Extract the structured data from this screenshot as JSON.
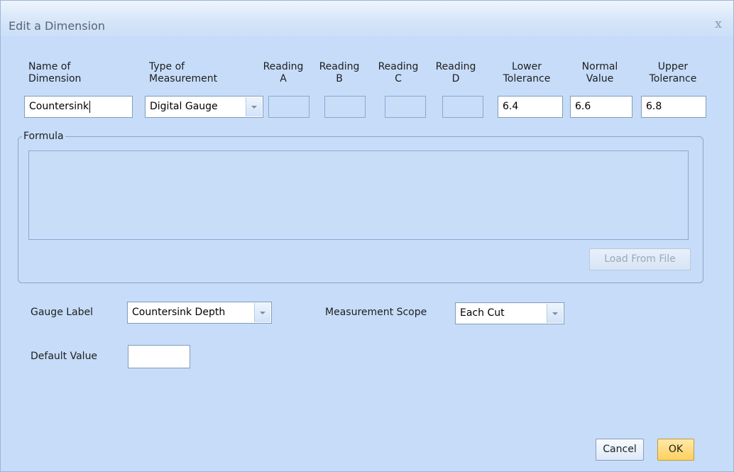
{
  "window": {
    "title": "Edit a Dimension",
    "close_glyph": "x"
  },
  "columns": {
    "name_of_dimension": {
      "line1": "Name of",
      "line2": "Dimension",
      "value": "Countersink"
    },
    "type_of_measurement": {
      "line1": "Type of",
      "line2": "Measurement",
      "value": "Digital Gauge"
    },
    "reading_a": {
      "line1": "Reading",
      "line2": "A",
      "value": ""
    },
    "reading_b": {
      "line1": "Reading",
      "line2": "B",
      "value": ""
    },
    "reading_c": {
      "line1": "Reading",
      "line2": "C",
      "value": ""
    },
    "reading_d": {
      "line1": "Reading",
      "line2": "D",
      "value": ""
    },
    "lower_tolerance": {
      "line1": "Lower",
      "line2": "Tolerance",
      "value": "6.4"
    },
    "normal_value": {
      "line1": "Normal",
      "line2": "Value",
      "value": "6.6"
    },
    "upper_tolerance": {
      "line1": "Upper",
      "line2": "Tolerance",
      "value": "6.8"
    }
  },
  "formula": {
    "legend": "Formula",
    "value": "",
    "load_button_label": "Load From File",
    "load_button_enabled": false
  },
  "gauge": {
    "label": "Gauge Label",
    "value": "Countersink Depth"
  },
  "scope": {
    "label": "Measurement Scope",
    "value": "Each Cut"
  },
  "default_value": {
    "label": "Default Value",
    "value": ""
  },
  "footer": {
    "cancel_label": "Cancel",
    "ok_label": "OK"
  },
  "colors": {
    "dialog_background": "#c6dcf8",
    "ok_button": "#ffd05e",
    "field_border": "#7f9db9"
  }
}
